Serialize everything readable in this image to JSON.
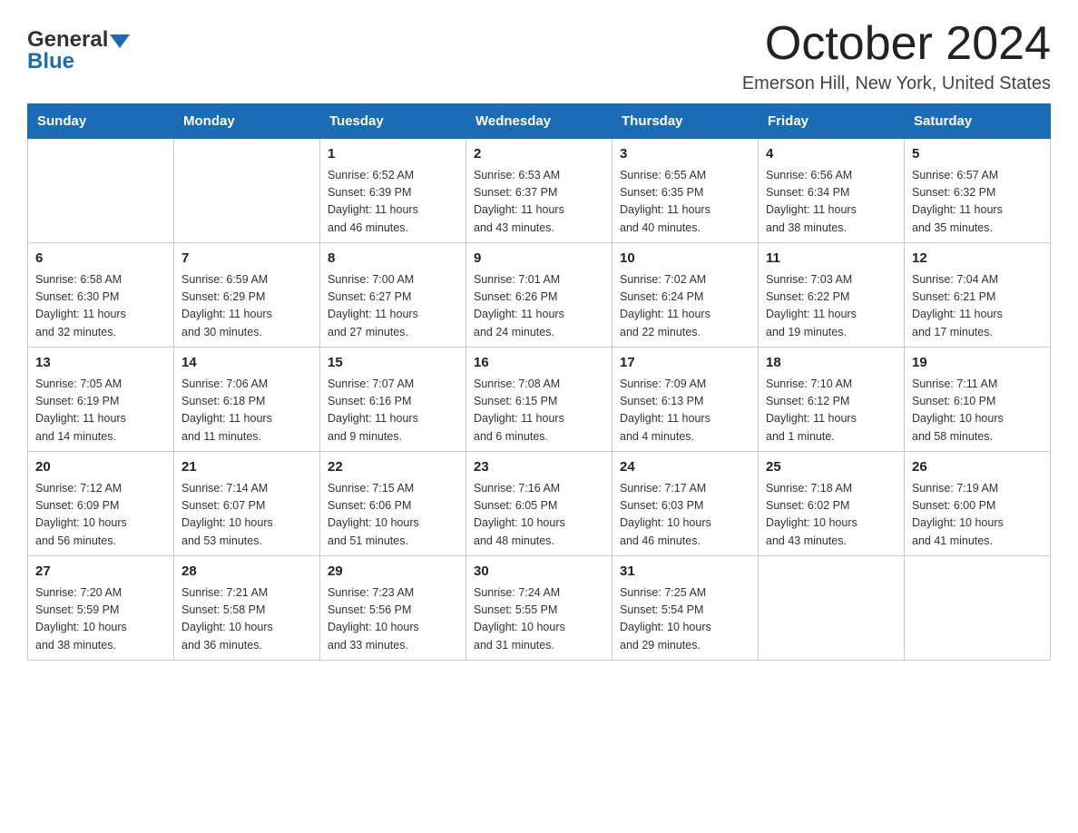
{
  "header": {
    "logo_line1": "General",
    "logo_line2": "Blue",
    "month_title": "October 2024",
    "location": "Emerson Hill, New York, United States"
  },
  "weekdays": [
    "Sunday",
    "Monday",
    "Tuesday",
    "Wednesday",
    "Thursday",
    "Friday",
    "Saturday"
  ],
  "weeks": [
    [
      {
        "day": "",
        "info": ""
      },
      {
        "day": "",
        "info": ""
      },
      {
        "day": "1",
        "info": "Sunrise: 6:52 AM\nSunset: 6:39 PM\nDaylight: 11 hours\nand 46 minutes."
      },
      {
        "day": "2",
        "info": "Sunrise: 6:53 AM\nSunset: 6:37 PM\nDaylight: 11 hours\nand 43 minutes."
      },
      {
        "day": "3",
        "info": "Sunrise: 6:55 AM\nSunset: 6:35 PM\nDaylight: 11 hours\nand 40 minutes."
      },
      {
        "day": "4",
        "info": "Sunrise: 6:56 AM\nSunset: 6:34 PM\nDaylight: 11 hours\nand 38 minutes."
      },
      {
        "day": "5",
        "info": "Sunrise: 6:57 AM\nSunset: 6:32 PM\nDaylight: 11 hours\nand 35 minutes."
      }
    ],
    [
      {
        "day": "6",
        "info": "Sunrise: 6:58 AM\nSunset: 6:30 PM\nDaylight: 11 hours\nand 32 minutes."
      },
      {
        "day": "7",
        "info": "Sunrise: 6:59 AM\nSunset: 6:29 PM\nDaylight: 11 hours\nand 30 minutes."
      },
      {
        "day": "8",
        "info": "Sunrise: 7:00 AM\nSunset: 6:27 PM\nDaylight: 11 hours\nand 27 minutes."
      },
      {
        "day": "9",
        "info": "Sunrise: 7:01 AM\nSunset: 6:26 PM\nDaylight: 11 hours\nand 24 minutes."
      },
      {
        "day": "10",
        "info": "Sunrise: 7:02 AM\nSunset: 6:24 PM\nDaylight: 11 hours\nand 22 minutes."
      },
      {
        "day": "11",
        "info": "Sunrise: 7:03 AM\nSunset: 6:22 PM\nDaylight: 11 hours\nand 19 minutes."
      },
      {
        "day": "12",
        "info": "Sunrise: 7:04 AM\nSunset: 6:21 PM\nDaylight: 11 hours\nand 17 minutes."
      }
    ],
    [
      {
        "day": "13",
        "info": "Sunrise: 7:05 AM\nSunset: 6:19 PM\nDaylight: 11 hours\nand 14 minutes."
      },
      {
        "day": "14",
        "info": "Sunrise: 7:06 AM\nSunset: 6:18 PM\nDaylight: 11 hours\nand 11 minutes."
      },
      {
        "day": "15",
        "info": "Sunrise: 7:07 AM\nSunset: 6:16 PM\nDaylight: 11 hours\nand 9 minutes."
      },
      {
        "day": "16",
        "info": "Sunrise: 7:08 AM\nSunset: 6:15 PM\nDaylight: 11 hours\nand 6 minutes."
      },
      {
        "day": "17",
        "info": "Sunrise: 7:09 AM\nSunset: 6:13 PM\nDaylight: 11 hours\nand 4 minutes."
      },
      {
        "day": "18",
        "info": "Sunrise: 7:10 AM\nSunset: 6:12 PM\nDaylight: 11 hours\nand 1 minute."
      },
      {
        "day": "19",
        "info": "Sunrise: 7:11 AM\nSunset: 6:10 PM\nDaylight: 10 hours\nand 58 minutes."
      }
    ],
    [
      {
        "day": "20",
        "info": "Sunrise: 7:12 AM\nSunset: 6:09 PM\nDaylight: 10 hours\nand 56 minutes."
      },
      {
        "day": "21",
        "info": "Sunrise: 7:14 AM\nSunset: 6:07 PM\nDaylight: 10 hours\nand 53 minutes."
      },
      {
        "day": "22",
        "info": "Sunrise: 7:15 AM\nSunset: 6:06 PM\nDaylight: 10 hours\nand 51 minutes."
      },
      {
        "day": "23",
        "info": "Sunrise: 7:16 AM\nSunset: 6:05 PM\nDaylight: 10 hours\nand 48 minutes."
      },
      {
        "day": "24",
        "info": "Sunrise: 7:17 AM\nSunset: 6:03 PM\nDaylight: 10 hours\nand 46 minutes."
      },
      {
        "day": "25",
        "info": "Sunrise: 7:18 AM\nSunset: 6:02 PM\nDaylight: 10 hours\nand 43 minutes."
      },
      {
        "day": "26",
        "info": "Sunrise: 7:19 AM\nSunset: 6:00 PM\nDaylight: 10 hours\nand 41 minutes."
      }
    ],
    [
      {
        "day": "27",
        "info": "Sunrise: 7:20 AM\nSunset: 5:59 PM\nDaylight: 10 hours\nand 38 minutes."
      },
      {
        "day": "28",
        "info": "Sunrise: 7:21 AM\nSunset: 5:58 PM\nDaylight: 10 hours\nand 36 minutes."
      },
      {
        "day": "29",
        "info": "Sunrise: 7:23 AM\nSunset: 5:56 PM\nDaylight: 10 hours\nand 33 minutes."
      },
      {
        "day": "30",
        "info": "Sunrise: 7:24 AM\nSunset: 5:55 PM\nDaylight: 10 hours\nand 31 minutes."
      },
      {
        "day": "31",
        "info": "Sunrise: 7:25 AM\nSunset: 5:54 PM\nDaylight: 10 hours\nand 29 minutes."
      },
      {
        "day": "",
        "info": ""
      },
      {
        "day": "",
        "info": ""
      }
    ]
  ]
}
